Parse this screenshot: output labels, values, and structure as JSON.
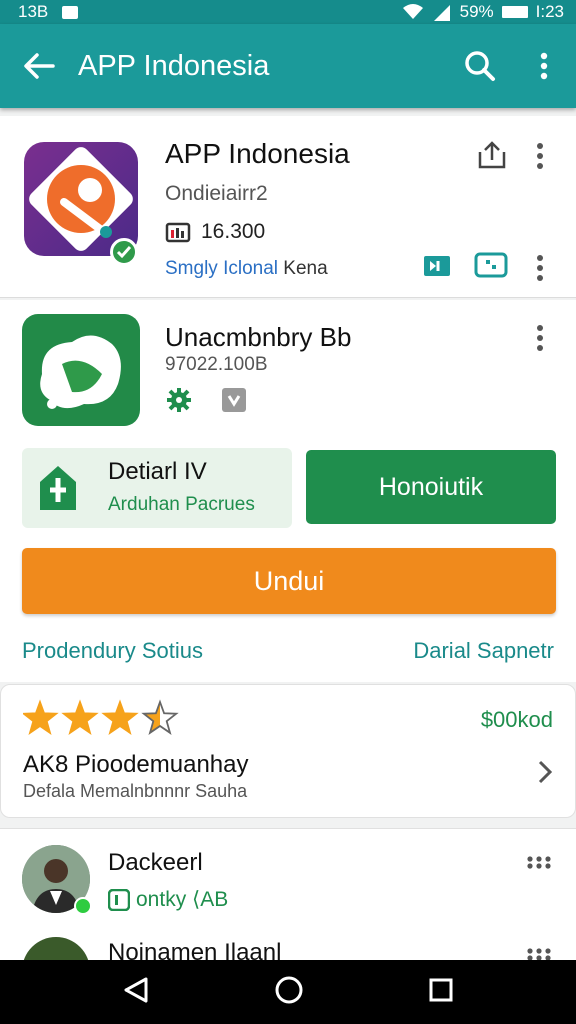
{
  "statusbar": {
    "left_text": "13B",
    "battery_pct": "59%",
    "time": "I:23"
  },
  "appbar": {
    "title": "APP Indonesia"
  },
  "app1": {
    "title": "APP Indonesia",
    "subtitle": "Ondieiairr2",
    "count": "16.300",
    "link": "Smgly Iclonal",
    "link_suffix": "Kena"
  },
  "app2": {
    "title": "Unacmbnbry Bb",
    "size": "97022.100B"
  },
  "detail": {
    "title": "Detiarl IV",
    "subtitle": "Arduhan Pacrues"
  },
  "buttons": {
    "green": "Honoiutik",
    "orange": "Undui"
  },
  "links": {
    "left": "Prodendury Sotius",
    "right": "Darial Sapnetr"
  },
  "rating": {
    "stars": 3.5,
    "price": "$00kod",
    "title": "AK8 Pioodemuanhay",
    "subtitle": "Defala Memalnbnnnr Sauha"
  },
  "review1": {
    "name": "Dackeerl",
    "tag": "ontky ⟨AB"
  },
  "review2": {
    "name": "Nojnamen Ilaanl"
  },
  "colors": {
    "teal": "#1b9a9a",
    "green": "#1f8e4d",
    "orange": "#f08a1c",
    "star": "#f6a21b"
  },
  "icons": [
    "back-arrow-icon",
    "search-icon",
    "more-vert-icon",
    "share-icon",
    "grid-count-icon",
    "flag-icon",
    "message-icon",
    "gear-icon",
    "tag-icon",
    "upload-icon",
    "star-icon",
    "chevron-right-icon",
    "more-horiz-icon",
    "nav-back-icon",
    "nav-home-icon",
    "nav-recents-icon"
  ]
}
